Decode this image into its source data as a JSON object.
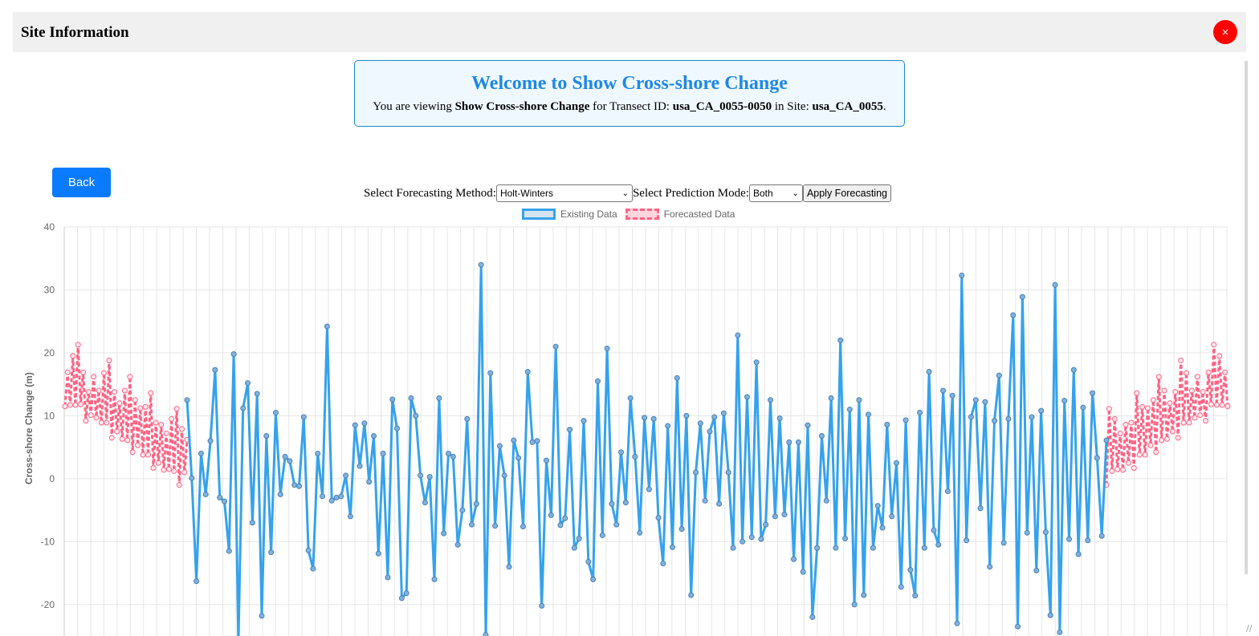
{
  "modal": {
    "title": "Site Information",
    "close_label": "×"
  },
  "welcome": {
    "title": "Welcome to Show Cross-shore Change",
    "prefix": "You are viewing ",
    "feature": "Show Cross-shore Change",
    "mid1": " for Transect ID: ",
    "transect_id": "usa_CA_0055-0050",
    "mid2": " in Site: ",
    "site": "usa_CA_0055",
    "suffix": "."
  },
  "back_label": "Back",
  "controls": {
    "method_label": "Select Forecasting Method:",
    "method_value": "Holt-Winters",
    "mode_label": "Select Prediction Mode:",
    "mode_value": "Both",
    "apply_label": "Apply Forecasting"
  },
  "colors": {
    "existing": "#36a2eb",
    "existing_fill": "#d6e4ef",
    "forecast": "#ff6384",
    "forecast_fill": "#ffd6de",
    "close_button": "#ff0000",
    "back_button": "#0a7bff",
    "title_blue": "#1e88e5"
  },
  "chart_data": {
    "type": "line",
    "ylabel": "Cross-shore Change (m)",
    "yticks": [
      "40",
      "30",
      "20",
      "10",
      "0",
      "-10",
      "-20"
    ],
    "ylim": [
      -25,
      40
    ],
    "grid": true,
    "legend_position": "top-center",
    "series": [
      {
        "name": "Existing Data",
        "values": [
          12.5,
          0.1,
          -16.3,
          4,
          -2.5,
          6,
          17.3,
          -3,
          -3.6,
          -11.5,
          19.8,
          -26,
          11.2,
          15.2,
          -7,
          13.5,
          -21.8,
          6.8,
          -11.7,
          10.5,
          -2.5,
          3.5,
          2.8,
          -1,
          -1.2,
          9.8,
          -11.4,
          -14.3,
          4,
          -2.8,
          24.2,
          -3.5,
          -3,
          -2.8,
          0.5,
          -6,
          8.5,
          2,
          8.8,
          -0.5,
          6.8,
          -11.9,
          4,
          -15.7,
          12.6,
          8,
          -19,
          -18.2,
          12.8,
          10,
          0.5,
          -3.8,
          0.3,
          -16,
          12.8,
          -8.7,
          4,
          3.5,
          -10.5,
          -5,
          9.5,
          -7.3,
          -4,
          34,
          -24.8,
          16.8,
          -7.5,
          5.2,
          0.5,
          -14,
          6.1,
          3.3,
          -7.6,
          17,
          5.8,
          6,
          -20.2,
          2.9,
          -5.8,
          21,
          -7.4,
          -6.3,
          7.8,
          -11,
          -9.5,
          9.2,
          -13.2,
          -16,
          15.5,
          -9,
          20.7,
          -4,
          -7.3,
          4.2,
          -3.8,
          12.8,
          3.5,
          -8.6,
          9.7,
          -1.7,
          9.5,
          -6.2,
          -13.5,
          8.4,
          -10.9,
          16,
          -8,
          10,
          -18.5,
          1,
          8.8,
          -3.5,
          7.5,
          9.8,
          -4,
          10.4,
          1,
          -11,
          22.8,
          -10,
          13,
          -9.3,
          18.5,
          -9.6,
          -7.3,
          12.5,
          -6,
          9.6,
          -5.7,
          5.8,
          -12.8,
          5.8,
          -14.8,
          8.5,
          -22,
          -11,
          6.8,
          -3.5,
          12.8,
          -11,
          22,
          -9.5,
          11,
          -20,
          12.5,
          -18.5,
          10.2,
          -11,
          -4.3,
          -7.8,
          8.6,
          -6,
          2.5,
          -17.2,
          9.3,
          -14.5,
          -18.6,
          10.5,
          -11,
          17,
          -8.2,
          -10.5,
          14,
          -2,
          13.2,
          -23,
          32.3,
          -9.8,
          9.8,
          12.5,
          -4.7,
          12.2,
          -14,
          9.2,
          16.4,
          -10.2,
          9.5,
          26,
          -23.5,
          28.9,
          -8.6,
          9.8,
          -14.6,
          10.8,
          -8.5,
          -21.7,
          30.8,
          -24.4,
          12.4,
          -9.6,
          17.3,
          -12,
          11.3,
          -9.8,
          13.6,
          3.3,
          -9.1,
          6.1
        ]
      },
      {
        "name": "Forecasted Data",
        "values_left": [
          11.5,
          16.9,
          11.7,
          19.5,
          11.7,
          21.3,
          11.8,
          16.9,
          9.2,
          13.8,
          10.1,
          16.2,
          9.7,
          14,
          8.9,
          16.8,
          8.9,
          18.8,
          6.5,
          13.8,
          7.5,
          12,
          6.3,
          14,
          6.1,
          16.2,
          4.2,
          12.5,
          5.3,
          11.2,
          3.8,
          11.4,
          3.8,
          13.6,
          1.7,
          8.9,
          2.5,
          8.6,
          1.4,
          7.2,
          1.5,
          9.5,
          1.2,
          11.1,
          -1,
          7.9,
          1,
          6.2
        ],
        "values_right": [
          -1,
          11.1,
          1.2,
          9.5,
          1.5,
          7.2,
          1.4,
          8.6,
          2.5,
          8.9,
          1.7,
          13.6,
          3.8,
          11.4,
          3.8,
          11.2,
          5.3,
          12.5,
          4.2,
          16.2,
          6.1,
          14,
          6.3,
          12,
          7.5,
          13.8,
          6.5,
          18.8,
          8.9,
          16.8,
          8.9,
          14,
          9.7,
          16.2,
          10.1,
          13.8,
          9.2,
          16.9,
          11.8,
          21.3,
          11.7,
          19.5,
          11.7,
          16.9,
          11.5
        ]
      }
    ]
  }
}
